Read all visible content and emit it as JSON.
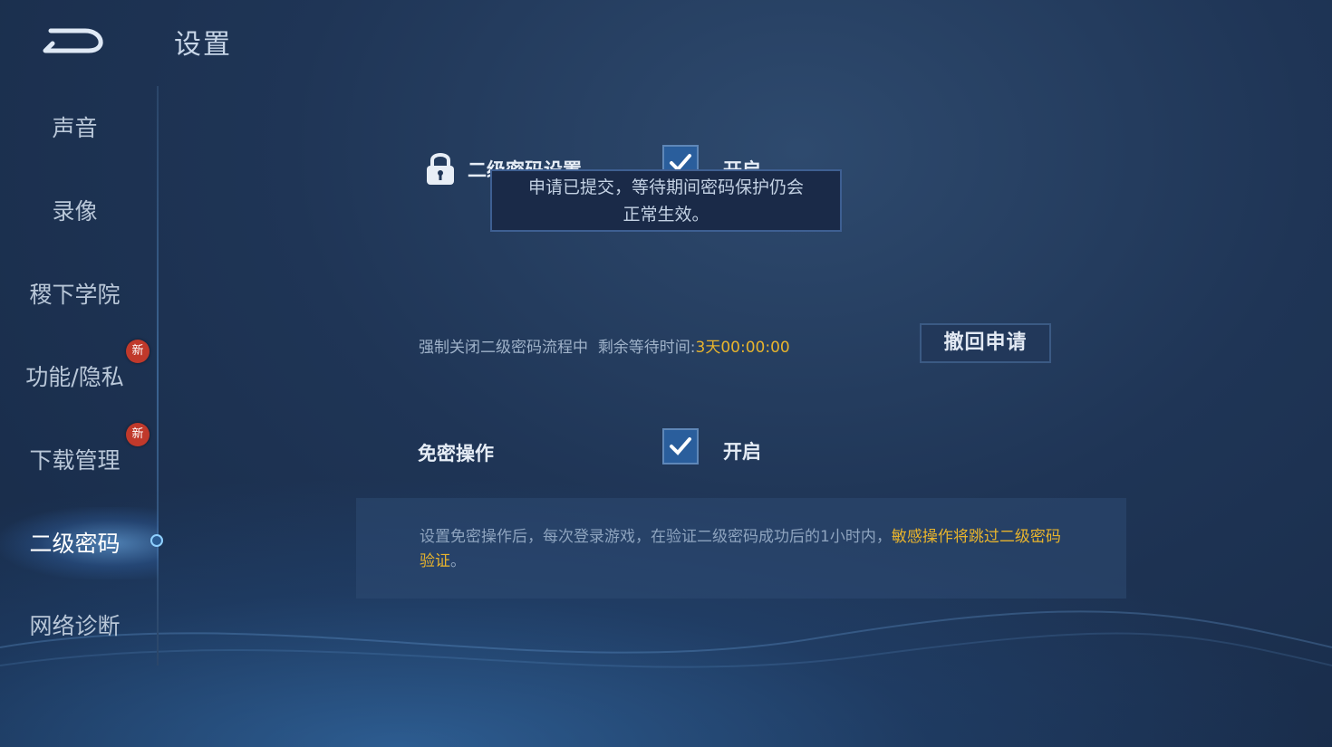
{
  "header": {
    "title": "设置"
  },
  "sidebar": {
    "items": [
      {
        "label": "声音"
      },
      {
        "label": "录像"
      },
      {
        "label": "稷下学院"
      },
      {
        "label": "功能/隐私",
        "badge": "新"
      },
      {
        "label": "下载管理",
        "badge": "新"
      },
      {
        "label": "二级密码",
        "active": true
      },
      {
        "label": "网络诊断"
      }
    ]
  },
  "secondary_password": {
    "label": "二级密码设置",
    "checked": true,
    "toggle_label": "开启"
  },
  "tooltip": {
    "line1": "申请已提交，等待期间密码保护仍会",
    "line2": "正常生效。"
  },
  "force_close": {
    "text": "强制关闭二级密码流程中",
    "remaining_label": "剩余等待时间:",
    "remaining_value": "3天00:00:00",
    "revoke_button": "撤回申请"
  },
  "password_free": {
    "label": "免密操作",
    "checked": true,
    "toggle_label": "开启"
  },
  "info": {
    "text_normal": "设置免密操作后，每次登录游戏，在验证二级密码成功后的1小时内，",
    "text_highlight": "敏感操作将跳过二级密码验证",
    "text_end": "。"
  },
  "colors": {
    "highlight": "#e8b42d",
    "accent": "#2a5e9c"
  }
}
